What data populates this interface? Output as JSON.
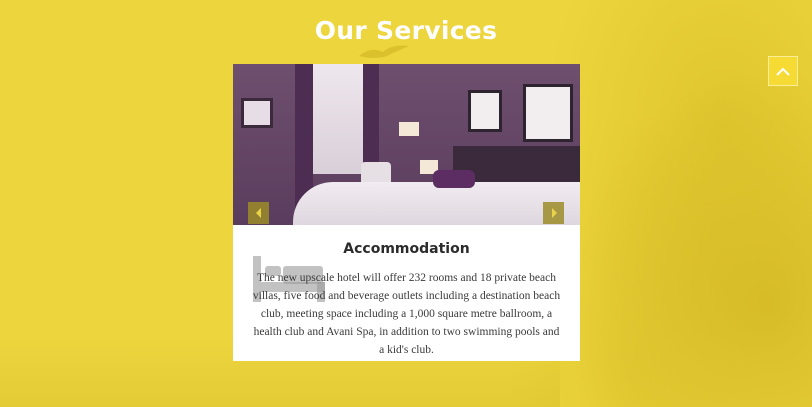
{
  "section": {
    "title": "Our Services"
  },
  "card": {
    "title": "Accommodation",
    "description": "The new upscale hotel will offer 232 rooms and 18 private beach villas, five food and beverage outlets including a destination beach club, meeting space including a 1,000 square metre ballroom, a health club and Avani Spa, in addition to two swimming pools and a kid's club.",
    "image_alt": "hotel-room-photo"
  },
  "icons": {
    "scroll_top": "chevron-up-icon",
    "prev": "chevron-left-icon",
    "next": "chevron-right-icon",
    "service": "bed-icon",
    "decor": "bird-icon"
  },
  "colors": {
    "background": "#ecd53d",
    "accent": "#f6db35",
    "card": "#ffffff",
    "title_text": "#ffffff",
    "card_title": "#2b2b2b"
  }
}
